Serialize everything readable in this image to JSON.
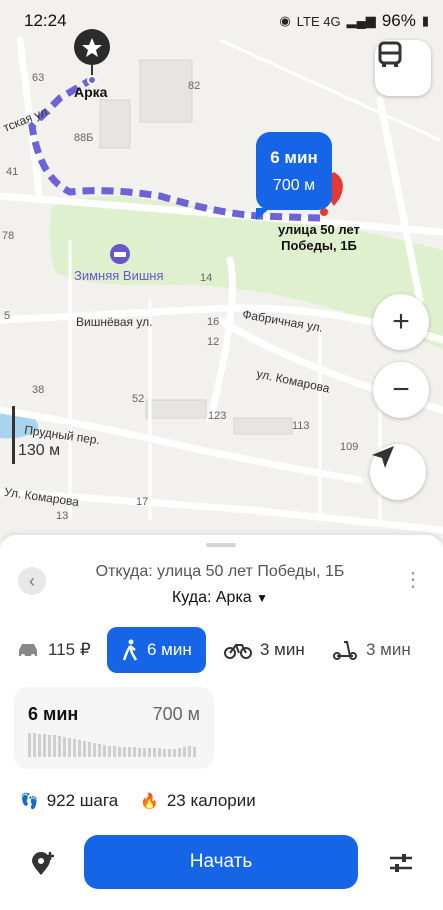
{
  "status_bar": {
    "time": "12:24",
    "network": "LTE 4G",
    "battery": "96%"
  },
  "map": {
    "start_label": "Арка",
    "destination_label": "улица 50 лет\nПобеды, 1Б",
    "destination_line1": "улица 50 лет",
    "destination_line2": "Победы, 1Б",
    "route_duration": "6 мин",
    "route_distance": "700 м",
    "poi": "Зимняя Вишня",
    "streets": {
      "s1": "Вишнёвая ул.",
      "s2": "Фабричная ул.",
      "s3": "ул. Комарова",
      "s4": "Прудный пер.",
      "s5": "Ул. Комарова",
      "s6": "тская ул."
    },
    "house_numbers": [
      "63",
      "82",
      "88Б",
      "41",
      "78",
      "14",
      "16",
      "12",
      "38",
      "52",
      "123",
      "113",
      "109",
      "17",
      "13",
      "5"
    ],
    "scale": "130 м"
  },
  "controls": {
    "zoom_in": "+",
    "zoom_out": "−"
  },
  "sheet": {
    "from_label": "Откуда: улица 50 лет Победы, 1Б",
    "to_label": "Куда: Арка",
    "modes": [
      {
        "name": "taxi",
        "label": "115 ₽"
      },
      {
        "name": "walk",
        "label": "6 мин"
      },
      {
        "name": "bike",
        "label": "3 мин"
      },
      {
        "name": "scooter",
        "label": "3 мин"
      }
    ],
    "route_card": {
      "duration": "6 мин",
      "distance": "700 м"
    },
    "steps": "922 шага",
    "calories": "23 калории",
    "start_button": "Начать"
  }
}
